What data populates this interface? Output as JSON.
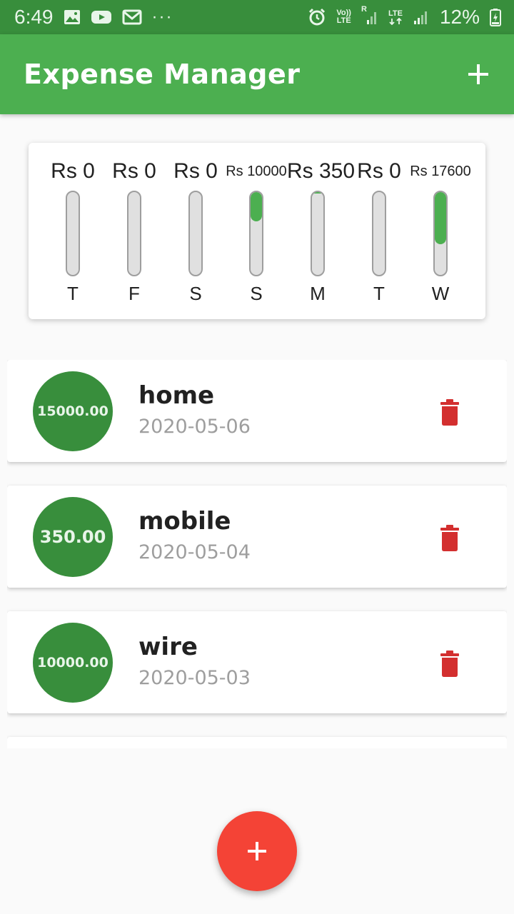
{
  "status_bar": {
    "time": "6:49",
    "more_dots": "···",
    "volte_top": "Vo))",
    "volte_bottom": "LTE",
    "roaming_r": "R",
    "lte_label": "LTE",
    "battery_percent": "12%"
  },
  "app_bar": {
    "title": "Expense Manager",
    "add_icon": "plus-icon"
  },
  "chart_data": {
    "type": "bar",
    "categories": [
      "T",
      "F",
      "S",
      "S",
      "M",
      "T",
      "W"
    ],
    "values": [
      0,
      0,
      0,
      10000,
      350,
      0,
      17600
    ],
    "labels": [
      "Rs 0",
      "Rs 0",
      "Rs 0",
      "Rs 10000",
      "Rs 350",
      "Rs 0",
      "Rs 17600"
    ],
    "fill_fraction": [
      0,
      0,
      0,
      0.35,
      0.02,
      0,
      0.63
    ],
    "bar_color": "#4caf50",
    "track_color": "#e0e0e0"
  },
  "expenses": [
    {
      "amount": "15000.00",
      "title": "home",
      "date": "2020-05-06"
    },
    {
      "amount": "350.00",
      "title": "mobile",
      "date": "2020-05-04"
    },
    {
      "amount": "10000.00",
      "title": "wire",
      "date": "2020-05-03"
    }
  ],
  "colors": {
    "status_bar": "#388e3c",
    "app_bar": "#4caf50",
    "amount_circle": "#388e3c",
    "delete": "#d32f2f",
    "fab": "#f44336"
  },
  "icons": {
    "delete": "trash-icon",
    "fab": "plus-icon"
  }
}
